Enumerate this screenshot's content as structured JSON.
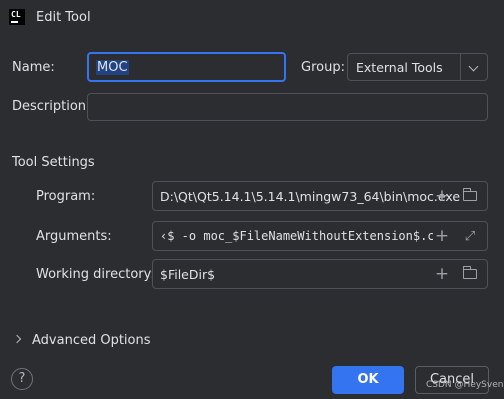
{
  "window": {
    "title": "Edit Tool",
    "app_icon_text": "CL"
  },
  "form": {
    "name_label": "Name:",
    "name_value": "MOC",
    "group_label": "Group:",
    "group_value": "External Tools",
    "description_label": "Description:",
    "description_value": ""
  },
  "tool_settings": {
    "title": "Tool Settings",
    "program_label": "Program:",
    "program_value": "D:\\Qt\\Qt5.14.1\\5.14.1\\mingw73_64\\bin\\moc.exe",
    "arguments_label": "Arguments:",
    "arguments_value": "‹$ -o moc_$FileNameWithoutExtension$.cpp",
    "working_dir_label": "Working directory:",
    "working_dir_value": "$FileDir$"
  },
  "advanced": {
    "label": "Advanced Options"
  },
  "footer": {
    "help_label": "?",
    "ok_label": "OK",
    "cancel_label": "Cancel",
    "watermark": "CSDN @HeySven"
  },
  "icons": {
    "add": "plus-icon",
    "browse": "folder-icon",
    "expand": "expand-icon",
    "dropdown": "chevron-down-icon"
  },
  "colors": {
    "accent": "#3574f0",
    "background": "#2b2d30",
    "selection": "#214283"
  }
}
